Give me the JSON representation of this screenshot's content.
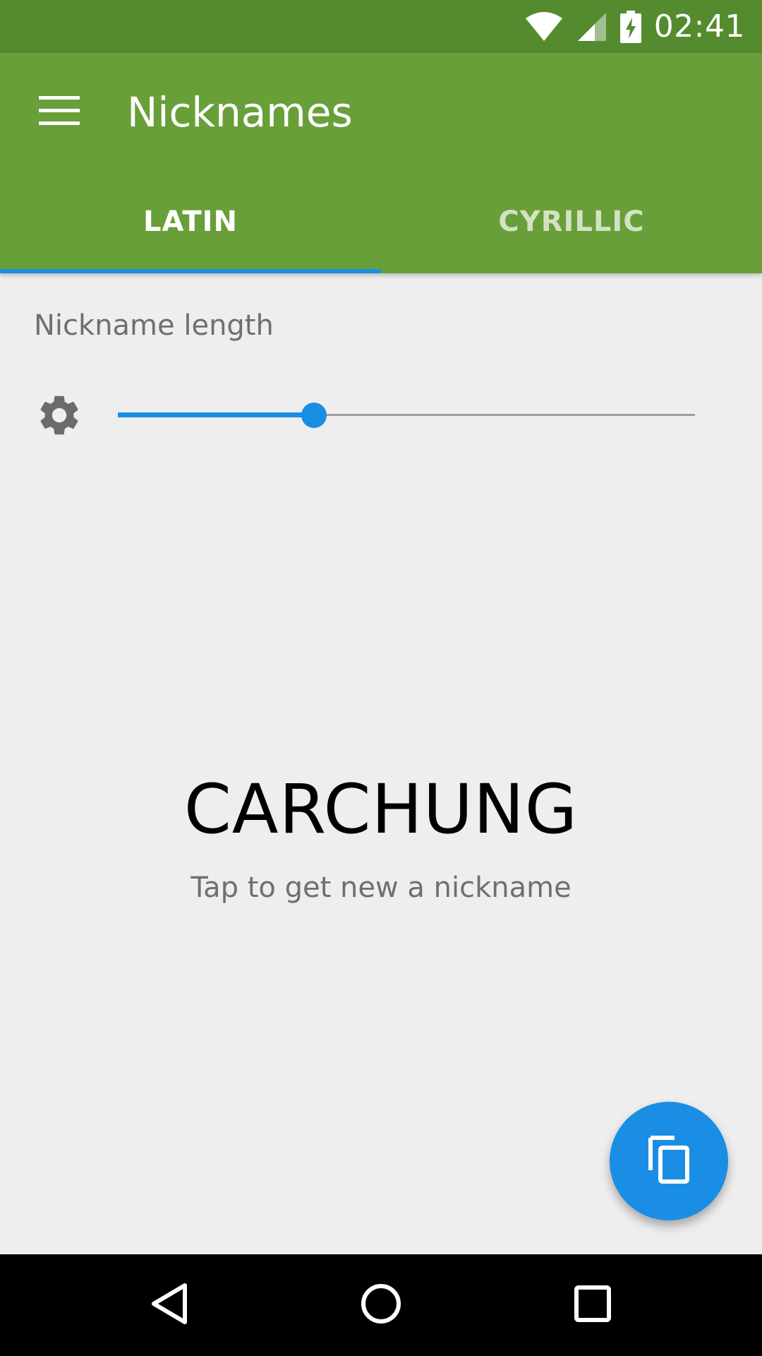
{
  "status_bar": {
    "time": "02:41",
    "icons": [
      "wifi-icon",
      "cell-signal-icon",
      "battery-charging-icon"
    ],
    "background": "#548b2e"
  },
  "app_bar": {
    "title": "Nicknames",
    "menu_icon": "hamburger-menu-icon",
    "background": "#689f38"
  },
  "tabs": [
    {
      "label": "LATIN",
      "active": true
    },
    {
      "label": "CYRILLIC",
      "active": false
    }
  ],
  "controls": {
    "length_label": "Nickname length",
    "settings_icon": "gear-icon",
    "slider_value_fraction": 0.34,
    "accent": "#1a8ee4"
  },
  "result": {
    "nickname": "CARCHUNG",
    "hint": "Tap to get new a nickname"
  },
  "fab": {
    "icon": "copy-icon"
  },
  "nav_bar": {
    "icons": [
      "back-icon",
      "home-icon",
      "recents-icon"
    ]
  }
}
